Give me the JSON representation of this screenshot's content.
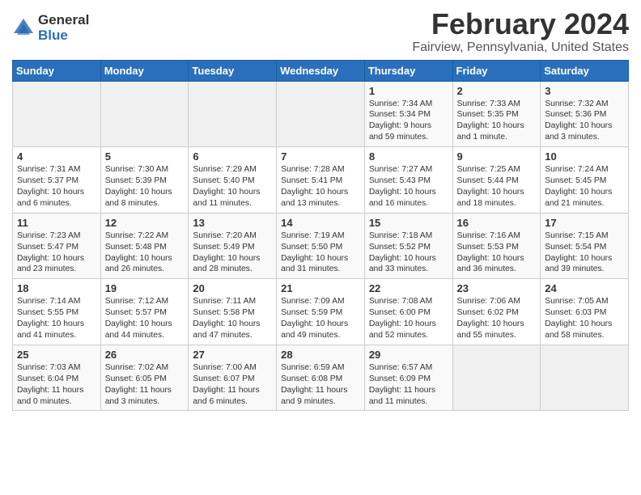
{
  "header": {
    "logo_general": "General",
    "logo_blue": "Blue",
    "title": "February 2024",
    "subtitle": "Fairview, Pennsylvania, United States"
  },
  "days_of_week": [
    "Sunday",
    "Monday",
    "Tuesday",
    "Wednesday",
    "Thursday",
    "Friday",
    "Saturday"
  ],
  "weeks": [
    [
      {
        "day": "",
        "content": ""
      },
      {
        "day": "",
        "content": ""
      },
      {
        "day": "",
        "content": ""
      },
      {
        "day": "",
        "content": ""
      },
      {
        "day": "1",
        "content": "Sunrise: 7:34 AM\nSunset: 5:34 PM\nDaylight: 9 hours\nand 59 minutes."
      },
      {
        "day": "2",
        "content": "Sunrise: 7:33 AM\nSunset: 5:35 PM\nDaylight: 10 hours\nand 1 minute."
      },
      {
        "day": "3",
        "content": "Sunrise: 7:32 AM\nSunset: 5:36 PM\nDaylight: 10 hours\nand 3 minutes."
      }
    ],
    [
      {
        "day": "4",
        "content": "Sunrise: 7:31 AM\nSunset: 5:37 PM\nDaylight: 10 hours\nand 6 minutes."
      },
      {
        "day": "5",
        "content": "Sunrise: 7:30 AM\nSunset: 5:39 PM\nDaylight: 10 hours\nand 8 minutes."
      },
      {
        "day": "6",
        "content": "Sunrise: 7:29 AM\nSunset: 5:40 PM\nDaylight: 10 hours\nand 11 minutes."
      },
      {
        "day": "7",
        "content": "Sunrise: 7:28 AM\nSunset: 5:41 PM\nDaylight: 10 hours\nand 13 minutes."
      },
      {
        "day": "8",
        "content": "Sunrise: 7:27 AM\nSunset: 5:43 PM\nDaylight: 10 hours\nand 16 minutes."
      },
      {
        "day": "9",
        "content": "Sunrise: 7:25 AM\nSunset: 5:44 PM\nDaylight: 10 hours\nand 18 minutes."
      },
      {
        "day": "10",
        "content": "Sunrise: 7:24 AM\nSunset: 5:45 PM\nDaylight: 10 hours\nand 21 minutes."
      }
    ],
    [
      {
        "day": "11",
        "content": "Sunrise: 7:23 AM\nSunset: 5:47 PM\nDaylight: 10 hours\nand 23 minutes."
      },
      {
        "day": "12",
        "content": "Sunrise: 7:22 AM\nSunset: 5:48 PM\nDaylight: 10 hours\nand 26 minutes."
      },
      {
        "day": "13",
        "content": "Sunrise: 7:20 AM\nSunset: 5:49 PM\nDaylight: 10 hours\nand 28 minutes."
      },
      {
        "day": "14",
        "content": "Sunrise: 7:19 AM\nSunset: 5:50 PM\nDaylight: 10 hours\nand 31 minutes."
      },
      {
        "day": "15",
        "content": "Sunrise: 7:18 AM\nSunset: 5:52 PM\nDaylight: 10 hours\nand 33 minutes."
      },
      {
        "day": "16",
        "content": "Sunrise: 7:16 AM\nSunset: 5:53 PM\nDaylight: 10 hours\nand 36 minutes."
      },
      {
        "day": "17",
        "content": "Sunrise: 7:15 AM\nSunset: 5:54 PM\nDaylight: 10 hours\nand 39 minutes."
      }
    ],
    [
      {
        "day": "18",
        "content": "Sunrise: 7:14 AM\nSunset: 5:55 PM\nDaylight: 10 hours\nand 41 minutes."
      },
      {
        "day": "19",
        "content": "Sunrise: 7:12 AM\nSunset: 5:57 PM\nDaylight: 10 hours\nand 44 minutes."
      },
      {
        "day": "20",
        "content": "Sunrise: 7:11 AM\nSunset: 5:58 PM\nDaylight: 10 hours\nand 47 minutes."
      },
      {
        "day": "21",
        "content": "Sunrise: 7:09 AM\nSunset: 5:59 PM\nDaylight: 10 hours\nand 49 minutes."
      },
      {
        "day": "22",
        "content": "Sunrise: 7:08 AM\nSunset: 6:00 PM\nDaylight: 10 hours\nand 52 minutes."
      },
      {
        "day": "23",
        "content": "Sunrise: 7:06 AM\nSunset: 6:02 PM\nDaylight: 10 hours\nand 55 minutes."
      },
      {
        "day": "24",
        "content": "Sunrise: 7:05 AM\nSunset: 6:03 PM\nDaylight: 10 hours\nand 58 minutes."
      }
    ],
    [
      {
        "day": "25",
        "content": "Sunrise: 7:03 AM\nSunset: 6:04 PM\nDaylight: 11 hours\nand 0 minutes."
      },
      {
        "day": "26",
        "content": "Sunrise: 7:02 AM\nSunset: 6:05 PM\nDaylight: 11 hours\nand 3 minutes."
      },
      {
        "day": "27",
        "content": "Sunrise: 7:00 AM\nSunset: 6:07 PM\nDaylight: 11 hours\nand 6 minutes."
      },
      {
        "day": "28",
        "content": "Sunrise: 6:59 AM\nSunset: 6:08 PM\nDaylight: 11 hours\nand 9 minutes."
      },
      {
        "day": "29",
        "content": "Sunrise: 6:57 AM\nSunset: 6:09 PM\nDaylight: 11 hours\nand 11 minutes."
      },
      {
        "day": "",
        "content": ""
      },
      {
        "day": "",
        "content": ""
      }
    ]
  ]
}
